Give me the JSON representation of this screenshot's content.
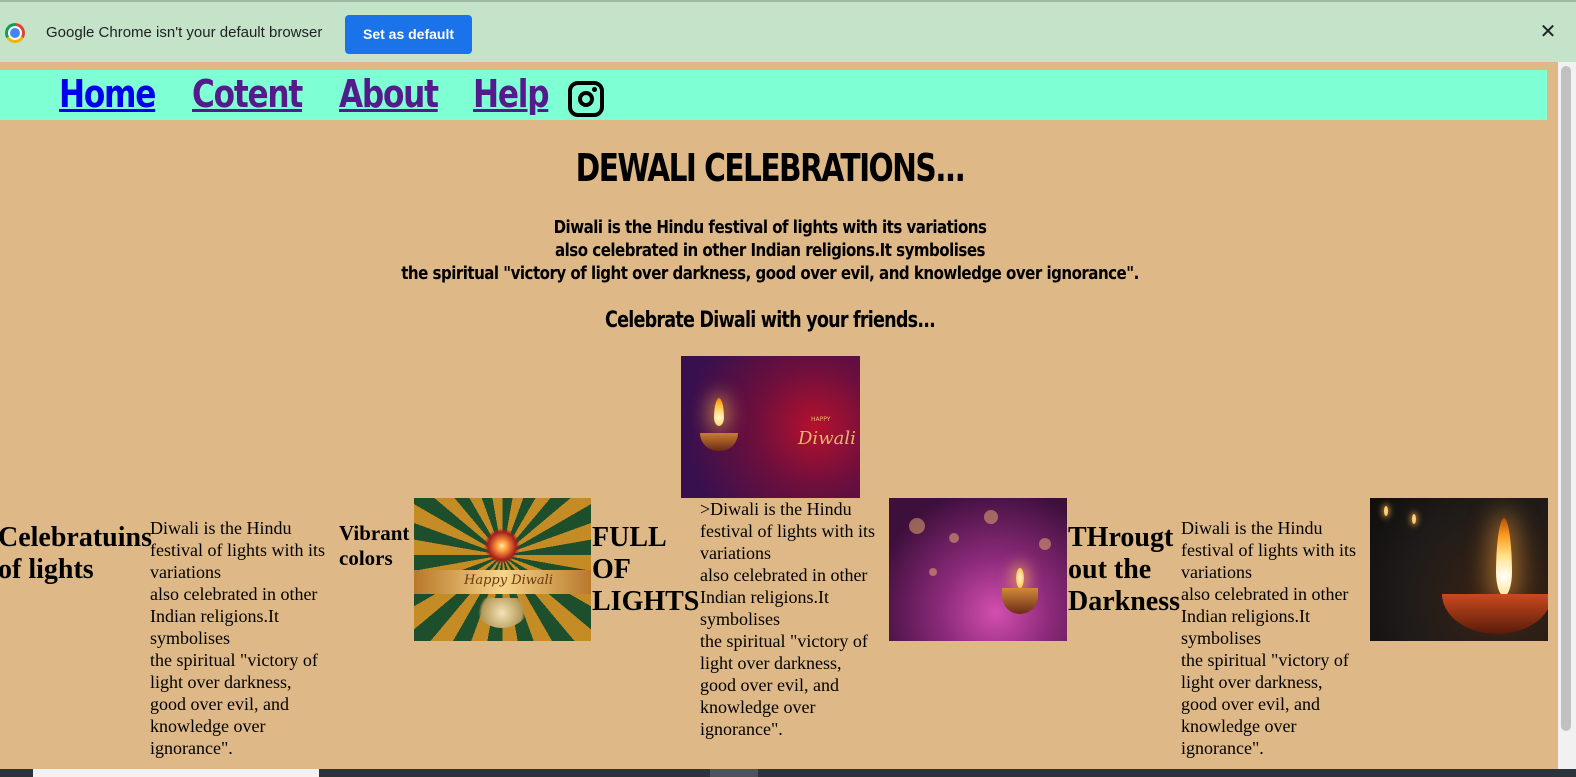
{
  "infobar": {
    "message": "Google Chrome isn't your default browser",
    "button_label": "Set as default",
    "close_glyph": "✕",
    "icon": "chrome-logo-icon"
  },
  "nav": {
    "background": "#7FFFD4",
    "links": [
      "Home",
      "Cotent",
      "About",
      "Help"
    ],
    "social_icon": "instagram-icon"
  },
  "page": {
    "background": "#DEB887",
    "title": "DEWALI CELEBRATIONS...",
    "intro_lines": [
      "Diwali is the Hindu festival of lights with its variations",
      "also celebrated in other Indian religions.It symbolises",
      "the spiritual \"victory of light over darkness, good over evil, and knowledge over ignorance\"."
    ],
    "subtitle": "Celebrate Diwali with your friends...",
    "hero_image_text": "Diwali",
    "hero_image_small_text": "HAPPY",
    "row": {
      "heading_1": [
        "Celebratuins",
        "of lights"
      ],
      "para_1": [
        "Diwali is the Hindu",
        "festival of lights with its",
        "variations",
        "also celebrated in other",
        "Indian religions.It",
        "symbolises",
        "the spiritual \"victory of",
        "light over darkness,",
        "good over evil, and",
        "knowledge over",
        "ignorance\"."
      ],
      "heading_2": [
        "Vibrant",
        "colors"
      ],
      "image_2_text": "Happy Diwali",
      "heading_3": [
        "FULL",
        "OF",
        "LIGHTS"
      ],
      "para_2": [
        ">Diwali is the Hindu",
        "festival of lights with its",
        "variations",
        "also celebrated in other",
        "Indian religions.It",
        "symbolises",
        "the spiritual \"victory of",
        "light over darkness,",
        "good over evil, and",
        "knowledge over",
        "ignorance\"."
      ],
      "heading_4": [
        "THrougt",
        "out the",
        "Darkness"
      ],
      "para_3": [
        "Diwali is the Hindu",
        "festival of lights with its",
        "variations",
        "also celebrated in other",
        "Indian religions.It",
        "symbolises",
        "the spiritual \"victory of",
        "light over darkness,",
        "good over evil, and",
        "knowledge over",
        "ignorance\"."
      ]
    }
  }
}
